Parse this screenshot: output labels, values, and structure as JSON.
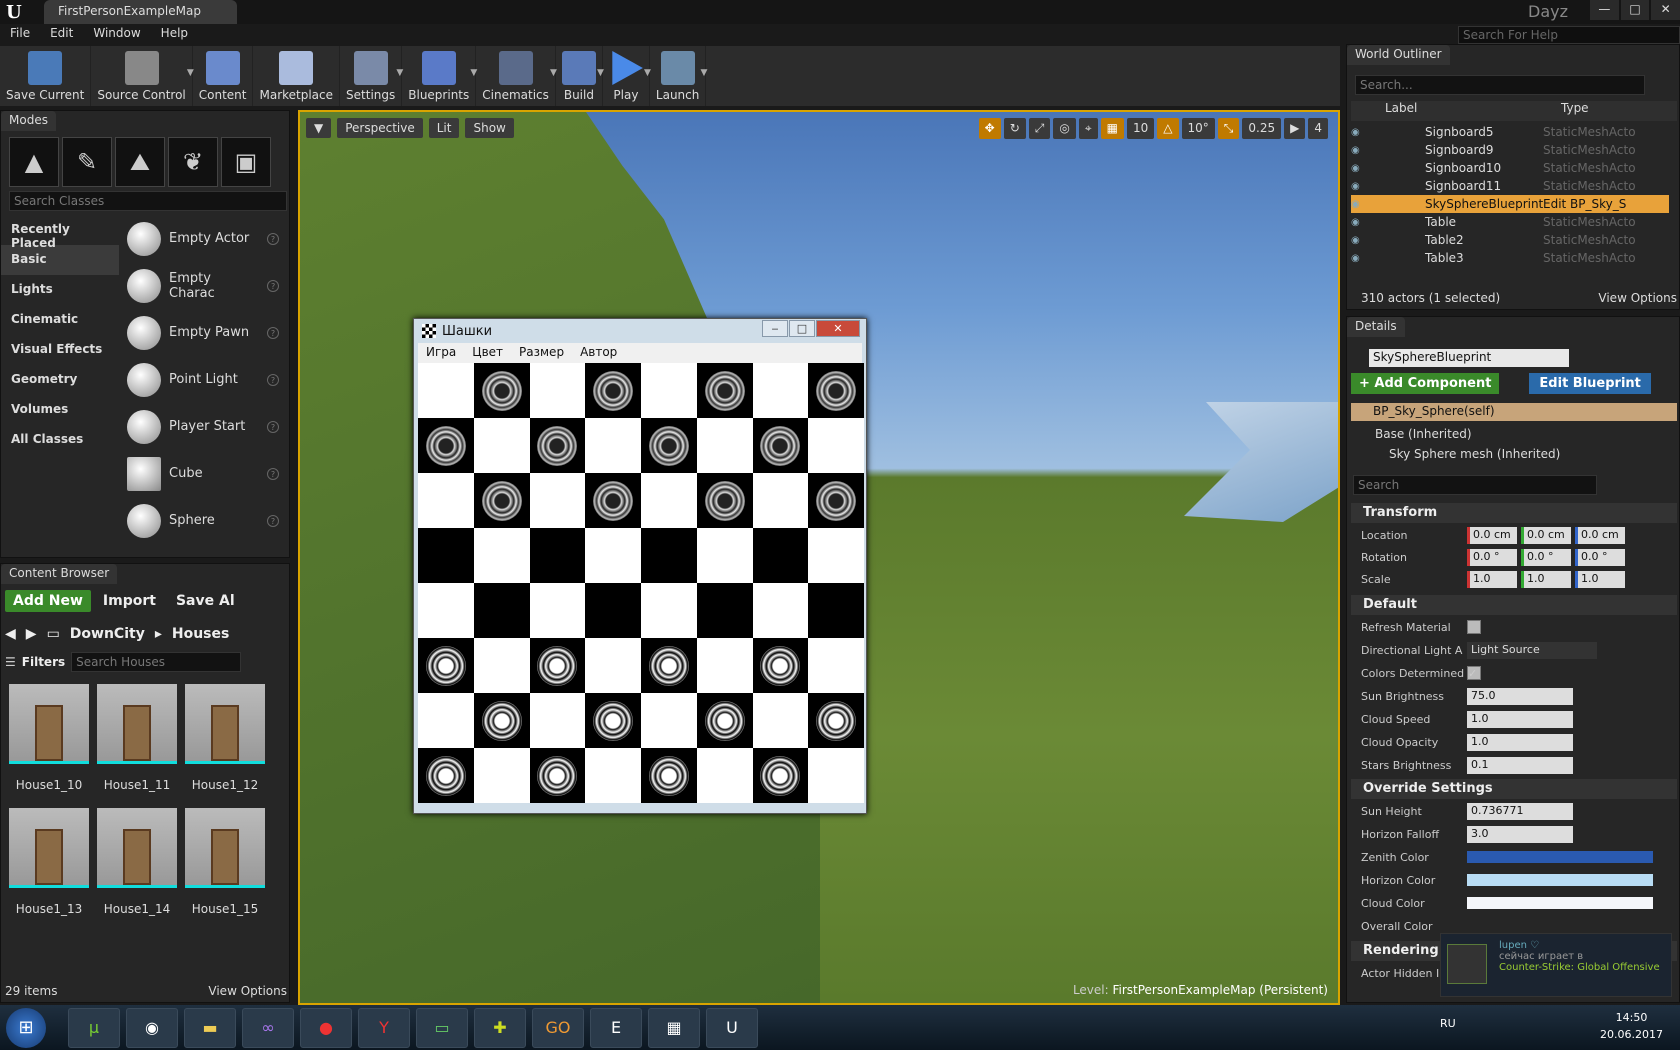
{
  "window": {
    "doc_tab": "FirstPersonExampleMap",
    "user": "Dayz",
    "help_search": "Search For Help",
    "controls": [
      "—",
      "□",
      "✕"
    ]
  },
  "menu": [
    "File",
    "Edit",
    "Window",
    "Help"
  ],
  "toolbar": [
    "Save Current",
    "Source Control",
    "Content",
    "Marketplace",
    "Settings",
    "Blueprints",
    "Cinematics",
    "Build",
    "Play",
    "Launch"
  ],
  "modes": {
    "tab": "Modes",
    "search_placeholder": "Search Classes",
    "categories": [
      "Recently Placed",
      "Basic",
      "Lights",
      "Cinematic",
      "Visual Effects",
      "Geometry",
      "Volumes",
      "All Classes"
    ],
    "classes": [
      "Empty Actor",
      "Empty Charac",
      "Empty Pawn",
      "Point Light",
      "Player Start",
      "Cube",
      "Sphere"
    ]
  },
  "content_browser": {
    "tab": "Content Browser",
    "add_new": "Add New",
    "import": "Import",
    "save_all": "Save Al",
    "path": [
      "DownCity",
      "Houses"
    ],
    "filters": "Filters",
    "search_placeholder": "Search Houses",
    "assets": [
      "House1_10",
      "House1_11",
      "House1_12",
      "House1_13",
      "House1_14",
      "House1_15"
    ],
    "count": "29 items",
    "view_options": "View Options"
  },
  "viewport": {
    "perspective": "Perspective",
    "lit": "Lit",
    "show": "Show",
    "grid": "10",
    "rot": "10°",
    "scale": "0.25",
    "cam": "4",
    "level_prefix": "Level:",
    "level_name": "FirstPersonExampleMap (Persistent)"
  },
  "checkers": {
    "title": "Шашки",
    "menu": [
      "Игра",
      "Цвет",
      "Размер",
      "Автор"
    ],
    "board": [
      [
        "",
        "b",
        "",
        "b",
        "",
        "b",
        "",
        "b"
      ],
      [
        "b",
        "",
        "b",
        "",
        "b",
        "",
        "b",
        ""
      ],
      [
        "",
        "b",
        "",
        "b",
        "",
        "b",
        "",
        "b"
      ],
      [
        "",
        "",
        "",
        "",
        "",
        "",
        "",
        ""
      ],
      [
        "",
        "",
        "",
        "",
        "",
        "",
        "",
        ""
      ],
      [
        "w",
        "",
        "w",
        "",
        "w",
        "",
        "w",
        ""
      ],
      [
        "",
        "w",
        "",
        "w",
        "",
        "w",
        "",
        "w"
      ],
      [
        "w",
        "",
        "w",
        "",
        "w",
        "",
        "w",
        ""
      ]
    ]
  },
  "outliner": {
    "tab": "World Outliner",
    "search_placeholder": "Search...",
    "col_label": "Label",
    "col_type": "Type",
    "rows": [
      {
        "label": "Signboard5",
        "type": "StaticMeshActo"
      },
      {
        "label": "Signboard9",
        "type": "StaticMeshActo"
      },
      {
        "label": "Signboard10",
        "type": "StaticMeshActo"
      },
      {
        "label": "Signboard11",
        "type": "StaticMeshActo"
      },
      {
        "label": "SkySphereBlueprint",
        "type": "Edit BP_Sky_S"
      },
      {
        "label": "Table",
        "type": "StaticMeshActo"
      },
      {
        "label": "Table2",
        "type": "StaticMeshActo"
      },
      {
        "label": "Table3",
        "type": "StaticMeshActo"
      }
    ],
    "count": "310 actors (1 selected)",
    "view_options": "View Options"
  },
  "details": {
    "tab": "Details",
    "name": "SkySphereBlueprint",
    "add_component": "+ Add Component",
    "edit_blueprint": "Edit Blueprint",
    "self": "BP_Sky_Sphere(self)",
    "base": "Base (Inherited)",
    "mesh": "Sky Sphere mesh (Inherited)",
    "search_placeholder": "Search",
    "transform": "Transform",
    "location_label": "Location",
    "location": [
      "0.0 cm",
      "0.0 cm",
      "0.0 cm"
    ],
    "rotation_label": "Rotation",
    "rotation": [
      "0.0 °",
      "0.0 °",
      "0.0 °"
    ],
    "scale_label": "Scale",
    "scale": [
      "1.0",
      "1.0",
      "1.0"
    ],
    "default": "Default",
    "refresh_material": "Refresh Material",
    "directional_light": "Directional Light A",
    "directional_light_value": "Light Source",
    "colors_determined": "Colors Determined",
    "sun_brightness": "Sun Brightness",
    "sun_brightness_value": "75.0",
    "cloud_speed": "Cloud Speed",
    "cloud_speed_value": "1.0",
    "cloud_opacity": "Cloud Opacity",
    "cloud_opacity_value": "1.0",
    "stars_brightness": "Stars Brightness",
    "stars_brightness_value": "0.1",
    "override": "Override Settings",
    "sun_height": "Sun Height",
    "sun_height_value": "0.736771",
    "horizon_falloff": "Horizon Falloff",
    "horizon_falloff_value": "3.0",
    "zenith_color": "Zenith Color",
    "horizon_color": "Horizon Color",
    "cloud_color": "Cloud Color",
    "overall_color": "Overall Color",
    "rendering": "Rendering",
    "actor_hidden": "Actor Hidden In"
  },
  "notification": {
    "user": "lupen ♡",
    "text": "сейчас играет в",
    "game": "Counter-Strike: Global Offensive"
  },
  "taskbar": {
    "lang": "RU",
    "time": "14:50",
    "date": "20.06.2017"
  }
}
